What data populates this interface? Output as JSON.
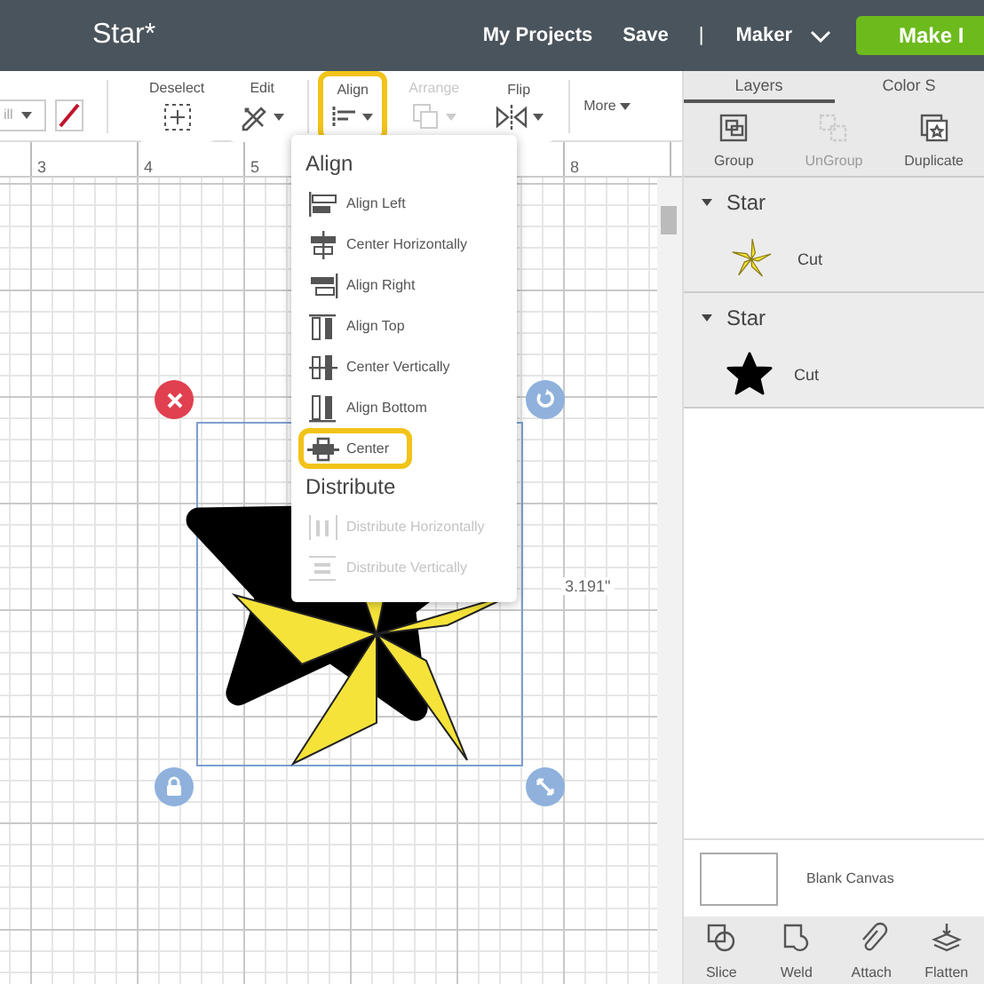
{
  "header": {
    "title": "Star*",
    "links": [
      {
        "label": "My Projects"
      },
      {
        "label": "Save"
      }
    ],
    "separator": "|",
    "machine": "Maker",
    "make_button": "Make I"
  },
  "toolbar": {
    "linetype_value": "ill",
    "tools": [
      {
        "label": "Deselect",
        "kind": "deselect",
        "disabled": false,
        "highlighted": false,
        "dropdown": false
      },
      {
        "label": "Edit",
        "kind": "edit",
        "disabled": false,
        "highlighted": false,
        "dropdown": true
      },
      {
        "label": "Align",
        "kind": "align",
        "disabled": false,
        "highlighted": true,
        "dropdown": true
      },
      {
        "label": "Arrange",
        "kind": "arrange",
        "disabled": true,
        "highlighted": false,
        "dropdown": true
      },
      {
        "label": "Flip",
        "kind": "flip",
        "disabled": false,
        "highlighted": false,
        "dropdown": true
      }
    ],
    "more": "More"
  },
  "ruler": {
    "left_marks": [
      "3",
      "4",
      "5"
    ],
    "right_marks": [
      "8"
    ]
  },
  "canvas": {
    "dimension": "3.191\""
  },
  "align_menu": {
    "sections": [
      {
        "heading": "Align",
        "items": [
          {
            "label": "Align Left",
            "kind": "align-left",
            "disabled": false,
            "highlighted": false
          },
          {
            "label": "Center Horizontally",
            "kind": "center-h",
            "disabled": false,
            "highlighted": false
          },
          {
            "label": "Align Right",
            "kind": "align-right",
            "disabled": false,
            "highlighted": false
          },
          {
            "label": "Align Top",
            "kind": "align-top",
            "disabled": false,
            "highlighted": false
          },
          {
            "label": "Center Vertically",
            "kind": "center-v",
            "disabled": false,
            "highlighted": false
          },
          {
            "label": "Align Bottom",
            "kind": "align-bottom",
            "disabled": false,
            "highlighted": false
          },
          {
            "label": "Center",
            "kind": "center",
            "disabled": false,
            "highlighted": true
          }
        ]
      },
      {
        "heading": "Distribute",
        "items": [
          {
            "label": "Distribute Horizontally",
            "kind": "dist-h",
            "disabled": true,
            "highlighted": false
          },
          {
            "label": "Distribute Vertically",
            "kind": "dist-v",
            "disabled": true,
            "highlighted": false
          }
        ]
      }
    ]
  },
  "panel": {
    "tabs": [
      {
        "label": "Layers",
        "selected": true
      },
      {
        "label": "Color S",
        "selected": false
      }
    ],
    "actions": [
      {
        "label": "Group",
        "kind": "group",
        "disabled": false
      },
      {
        "label": "UnGroup",
        "kind": "ungroup",
        "disabled": true
      },
      {
        "label": "Duplicate",
        "kind": "duplicate",
        "disabled": false
      }
    ],
    "layers": [
      {
        "name": "Star",
        "expanded": true,
        "children": [
          {
            "label": "Cut",
            "kind": "pinwheel"
          }
        ]
      },
      {
        "name": "Star",
        "expanded": true,
        "children": [
          {
            "label": "Cut",
            "kind": "star"
          }
        ]
      }
    ],
    "blank_canvas": "Blank Canvas",
    "bottom_actions": [
      {
        "label": "Slice",
        "kind": "slice"
      },
      {
        "label": "Weld",
        "kind": "weld"
      },
      {
        "label": "Attach",
        "kind": "attach"
      },
      {
        "label": "Flatten",
        "kind": "flatten"
      }
    ]
  }
}
